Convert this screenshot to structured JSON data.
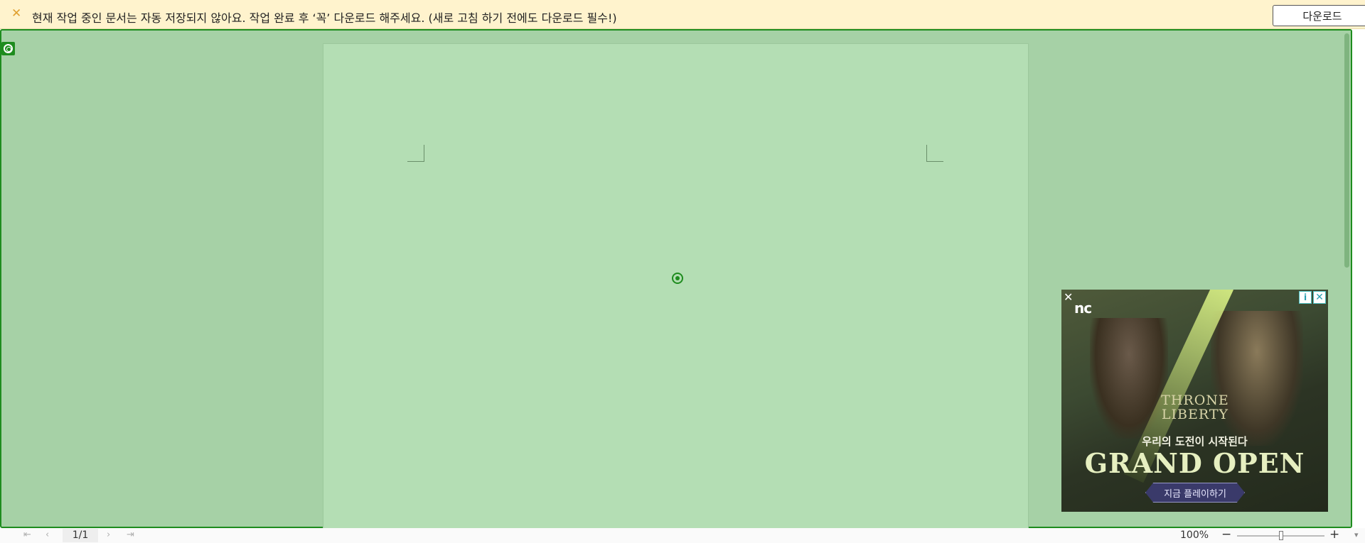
{
  "notice": {
    "message": "현재 작업 중인 문서는 자동 저장되지 않아요. 작업 완료 후 ‘꼭’ 다운로드 해주세요. (새로 고침 하기 전에도 다운로드 필수!)",
    "download_label": "다운로드",
    "close_glyph": "✕"
  },
  "ad": {
    "brand": "nc",
    "logo_line1": "THRONE",
    "logo_line2": "LIBERTY",
    "tagline": "우리의 도전이 시작된다",
    "headline": "GRAND OPEN",
    "cta": "지금 플레이하기",
    "close_glyph": "✕",
    "info_glyph": "i"
  },
  "status": {
    "page_indicator": "1/1",
    "zoom": "100%",
    "zoom_level": 0.5,
    "nav_first": "⇤",
    "nav_prev": "‹",
    "nav_next": "›",
    "nav_last": "⇥",
    "minus": "−",
    "plus": "+"
  },
  "colors": {
    "overlay": "#a6d1a6",
    "frame": "#1e8c1e",
    "notice_bg": "#fff3cd"
  }
}
